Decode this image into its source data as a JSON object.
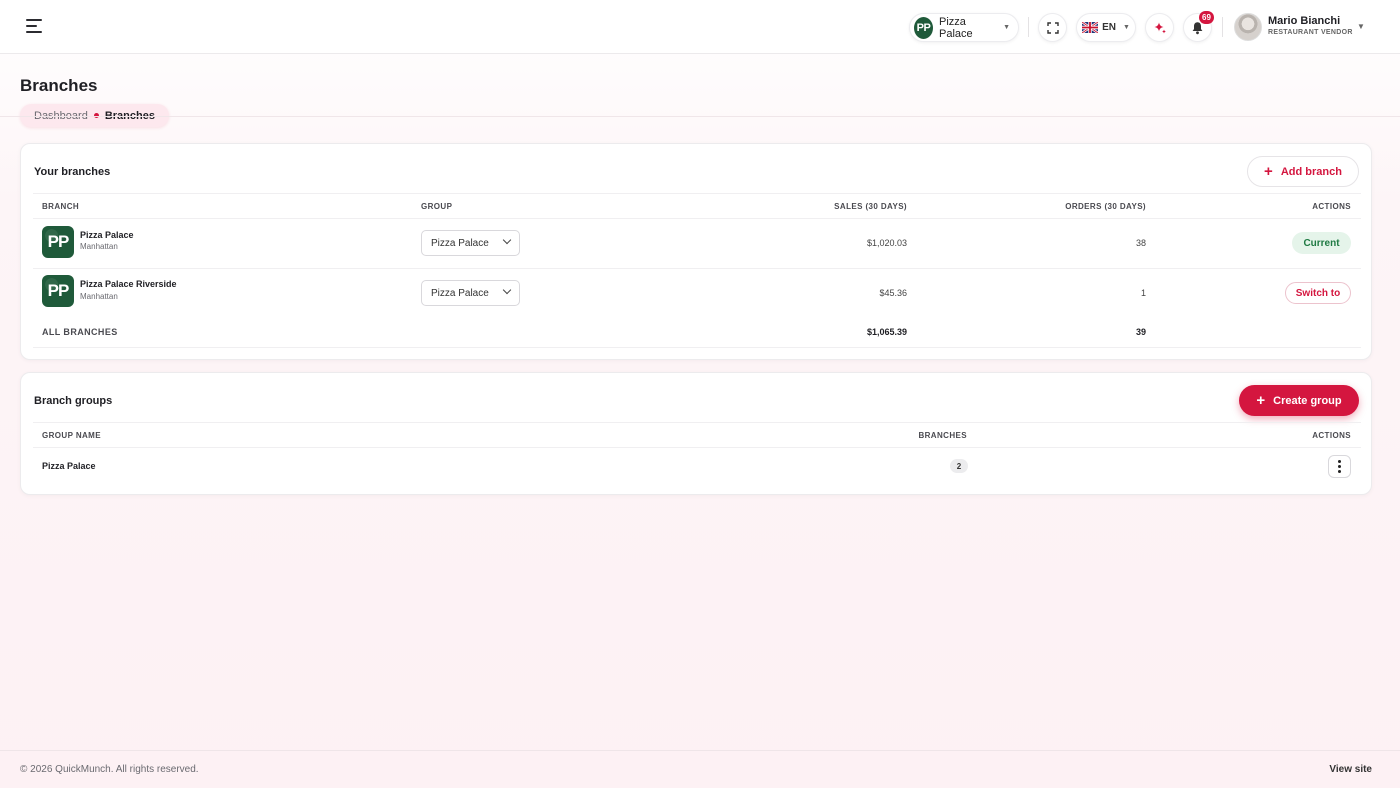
{
  "topbar": {
    "store_switcher": {
      "logo_text": "PP",
      "name": "Pizza Palace"
    },
    "language": {
      "code": "EN"
    },
    "notifications": {
      "count": "69"
    },
    "user": {
      "name": "Mario Bianchi",
      "role": "RESTAURANT VENDOR"
    }
  },
  "page": {
    "title": "Branches",
    "breadcrumb": {
      "home": "Dashboard",
      "current": "Branches"
    }
  },
  "branches_card": {
    "title": "Your branches",
    "add_label": "Add branch",
    "columns": [
      "BRANCH",
      "GROUP",
      "SALES (30 DAYS)",
      "ORDERS (30 DAYS)",
      "ACTIONS"
    ],
    "rows": [
      {
        "logo": "PP",
        "name": "Pizza Palace",
        "location": "Manhattan",
        "group": "Pizza Palace",
        "sales": "$1,020.03",
        "orders": "38",
        "action": "Current"
      },
      {
        "logo": "PP",
        "name": "Pizza Palace Riverside",
        "location": "Manhattan",
        "group": "Pizza Palace",
        "sales": "$45.36",
        "orders": "1",
        "action": "Switch to"
      }
    ],
    "totals": {
      "label": "ALL BRANCHES",
      "sales": "$1,065.39",
      "orders": "39"
    }
  },
  "groups_card": {
    "title": "Branch groups",
    "create_label": "Create group",
    "columns": [
      "GROUP NAME",
      "BRANCHES",
      "ACTIONS"
    ],
    "rows": [
      {
        "name": "Pizza Palace",
        "branches": "2"
      }
    ]
  },
  "footer": {
    "copyright": "© 2026 QuickMunch. All rights reserved.",
    "view_site": "View site"
  },
  "colors": {
    "accent": "#d4163f",
    "brand_green": "#1f5a3a",
    "current_bg": "#e5f4ea",
    "current_text": "#1f7a43"
  },
  "icons": {
    "menu": "menu-icon",
    "fullscreen": "fullscreen-icon",
    "flag": "uk-flag-icon",
    "ai": "sparkle-icon",
    "notifications": "bell-icon",
    "plus": "plus-icon",
    "more": "kebab-icon"
  }
}
